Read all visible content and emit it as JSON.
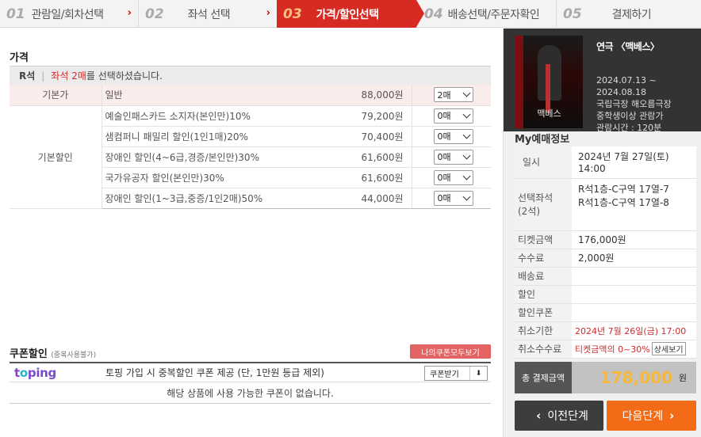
{
  "steps": [
    {
      "num": "01",
      "label": "관람일/회차선택"
    },
    {
      "num": "02",
      "label": "좌석 선택"
    },
    {
      "num": "03",
      "label": "가격/할인선택"
    },
    {
      "num": "04",
      "label": "배송선택/주문자확인"
    },
    {
      "num": "05",
      "label": "결제하기"
    }
  ],
  "price": {
    "title": "가격",
    "seat_grade": "R석",
    "seat_highlight": "좌석 2매",
    "seat_suffix": "를 선택하셨습니다.",
    "rows": [
      {
        "category": "기본가",
        "name": "일반",
        "amount": "88,000원",
        "qty": "2매"
      },
      {
        "category": "기본할인",
        "name": "예술인패스카드 소지자(본인만)10%",
        "amount": "79,200원",
        "qty": "0매"
      },
      {
        "category": "",
        "name": "샘컴퍼니 패밀리 할인(1인1매)20%",
        "amount": "70,400원",
        "qty": "0매"
      },
      {
        "category": "",
        "name": "장애인 할인(4~6급,경증/본인만)30%",
        "amount": "61,600원",
        "qty": "0매"
      },
      {
        "category": "",
        "name": "국가유공자 할인(본인만)30%",
        "amount": "61,600원",
        "qty": "0매"
      },
      {
        "category": "",
        "name": "장애인 할인(1~3급,중증/1인2매)50%",
        "amount": "44,000원",
        "qty": "0매"
      }
    ]
  },
  "coupon": {
    "title": "쿠폰할인",
    "note": "(중복사용불가)",
    "my_coupon_button": "나의쿠폰모두보기",
    "brand": "toping",
    "text": "토핑 가입 시 중복할인 쿠폰 제공 (단, 1만원 등급 제외)",
    "get_button": "쿠폰받기",
    "empty": "해당 상품에 사용 가능한 쿠폰이 없습니다."
  },
  "show": {
    "title": "연극 〈맥베스〉",
    "poster_title": "맥베스",
    "dates": "2024.07.13 ~\n2024.08.18",
    "venue": "국립극장 해오름극장",
    "age": "중학생이상 관람가",
    "runtime": "관람시간 : 120분"
  },
  "my_info": {
    "title": "My예매정보",
    "date_label": "일시",
    "date_value": "2024년 7월 27일(토)",
    "time_value": "14:00",
    "seat_label": "선택좌석",
    "seat_count": "(2석)",
    "seat_1": "R석1층-C구역 17열-7",
    "seat_2": "R석1층-C구역 17열-8",
    "ticket_label": "티켓금액",
    "ticket_value": "176,000원",
    "fee_label": "수수료",
    "fee_value": "2,000원",
    "delivery_label": "배송료",
    "discount_label": "할인",
    "coupon_label": "할인쿠폰",
    "cancel_deadline_label": "취소기한",
    "cancel_deadline_value": "2024년 7월 26일(금) 17:00",
    "cancel_fee_label": "취소수수료",
    "cancel_fee_value": "티켓금액의 0~30%",
    "detail_button": "상세보기",
    "total_label": "총 결제금액",
    "total_value": "178,000",
    "total_unit": "원"
  },
  "nav": {
    "prev": "이전단계",
    "next": "다음단계"
  }
}
